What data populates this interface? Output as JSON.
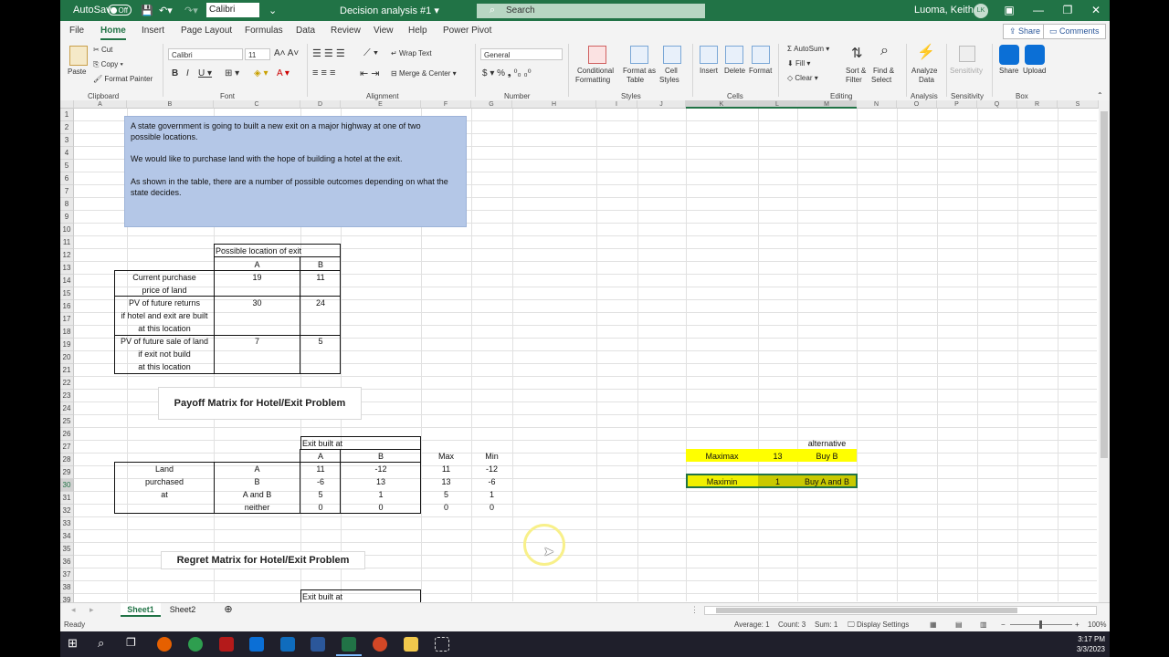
{
  "titlebar": {
    "autosave_label": "AutoSave",
    "autosave_state": "Off",
    "font_box": "Calibri",
    "document_title": "Decision analysis #1 ▾",
    "search_placeholder": "Search",
    "user_name": "Luoma, Keith E.",
    "user_initials": "LK"
  },
  "menu": {
    "items": [
      "File",
      "Home",
      "Insert",
      "Page Layout",
      "Formulas",
      "Data",
      "Review",
      "View",
      "Help",
      "Power Pivot"
    ],
    "active": "Home",
    "share_label": "Share",
    "comments_label": "Comments"
  },
  "ribbon": {
    "clipboard": {
      "paste": "Paste",
      "cut": "Cut",
      "copy": "Copy",
      "format_painter": "Format Painter",
      "group": "Clipboard"
    },
    "font": {
      "name": "Calibri",
      "size": "11",
      "group": "Font"
    },
    "alignment": {
      "wrap_text": "Wrap Text",
      "merge_center": "Merge & Center",
      "group": "Alignment"
    },
    "number": {
      "format": "General",
      "group": "Number"
    },
    "styles": {
      "conditional_1": "Conditional",
      "conditional_2": "Formatting",
      "format_table_1": "Format as",
      "format_table_2": "Table",
      "cell_styles_1": "Cell",
      "cell_styles_2": "Styles",
      "group": "Styles"
    },
    "cells": {
      "insert": "Insert",
      "delete": "Delete",
      "format": "Format",
      "group": "Cells"
    },
    "editing": {
      "autosum": "AutoSum",
      "fill": "Fill",
      "clear": "Clear",
      "sort_1": "Sort &",
      "sort_2": "Filter",
      "find_1": "Find &",
      "find_2": "Select",
      "group": "Editing"
    },
    "analysis": {
      "analyze_1": "Analyze",
      "analyze_2": "Data",
      "group": "Analysis"
    },
    "sensitivity": {
      "label": "Sensitivity",
      "group": "Sensitivity"
    },
    "box": {
      "share": "Share",
      "upload": "Upload",
      "group": "Box"
    }
  },
  "grid": {
    "columns": [
      "A",
      "B",
      "C",
      "D",
      "E",
      "F",
      "G",
      "H",
      "I",
      "J",
      "K",
      "L",
      "M",
      "N",
      "O",
      "P",
      "Q",
      "R",
      "S"
    ],
    "rows": [
      "1",
      "2",
      "3",
      "4",
      "5",
      "6",
      "7",
      "8",
      "9",
      "10",
      "11",
      "12",
      "13",
      "14",
      "15",
      "16",
      "17",
      "18",
      "19",
      "20",
      "21",
      "22",
      "23",
      "24",
      "25",
      "26",
      "27",
      "28",
      "29",
      "30",
      "31",
      "32",
      "33",
      "34",
      "35",
      "36",
      "37",
      "38",
      "39"
    ]
  },
  "note": {
    "line1": "A state government is going to built a new exit on a major highway at one of two",
    "line2": "possible locations.",
    "line3": "We would like to purchase land with the hope of building a hotel at the exit.",
    "line4": "As shown in the table, there are a number of possible outcomes depending on what the",
    "line5": "state decides."
  },
  "location_table": {
    "header": "Possible location of exit",
    "col_a": "A",
    "col_b": "B",
    "r1_l1": "Current purchase",
    "r1_l2": "price of land",
    "r1_a": "19",
    "r1_b": "11",
    "r2_l1": "PV of future returns",
    "r2_l2": "if hotel and exit are built",
    "r2_l3": "at this location",
    "r2_a": "30",
    "r2_b": "24",
    "r3_l1": "PV of future sale of land",
    "r3_l2": "if exit not build",
    "r3_l3": "at this location",
    "r3_a": "7",
    "r3_b": "5"
  },
  "payoff": {
    "title": "Payoff Matrix for Hotel/Exit Problem",
    "exit_header": "Exit built at",
    "col_a": "A",
    "col_b": "B",
    "max": "Max",
    "min": "Min",
    "land_1": "Land",
    "land_2": "purchased",
    "land_3": "at",
    "rows": [
      {
        "label": "A",
        "a": "11",
        "b": "-12",
        "max": "11",
        "min": "-12"
      },
      {
        "label": "B",
        "a": "-6",
        "b": "13",
        "max": "13",
        "min": "-6"
      },
      {
        "label": "A and B",
        "a": "5",
        "b": "1",
        "max": "5",
        "min": "1"
      },
      {
        "label": "neither",
        "a": "0",
        "b": "0",
        "max": "0",
        "min": "0"
      }
    ]
  },
  "decision": {
    "alternative": "alternative",
    "maximax_label": "Maximax",
    "maximax_value": "13",
    "maximax_alt": "Buy B",
    "maximin_label": "Maximin",
    "maximin_value": "1",
    "maximin_alt": "Buy A and B"
  },
  "regret": {
    "title": "Regret Matrix for Hotel/Exit Problem",
    "exit_header": "Exit built at"
  },
  "sheets": {
    "tabs": [
      "Sheet1",
      "Sheet2"
    ],
    "active": "Sheet1"
  },
  "status": {
    "ready": "Ready",
    "average": "Average: 1",
    "count": "Count: 3",
    "sum": "Sum: 1",
    "display_settings": "Display Settings",
    "zoom": "100%"
  },
  "taskbar": {
    "time": "3:17 PM",
    "date": "3/3/2023"
  },
  "colors": {
    "excel_green": "#217346",
    "note_blue": "#b4c7e7",
    "highlight_yellow": "#ffff00"
  }
}
